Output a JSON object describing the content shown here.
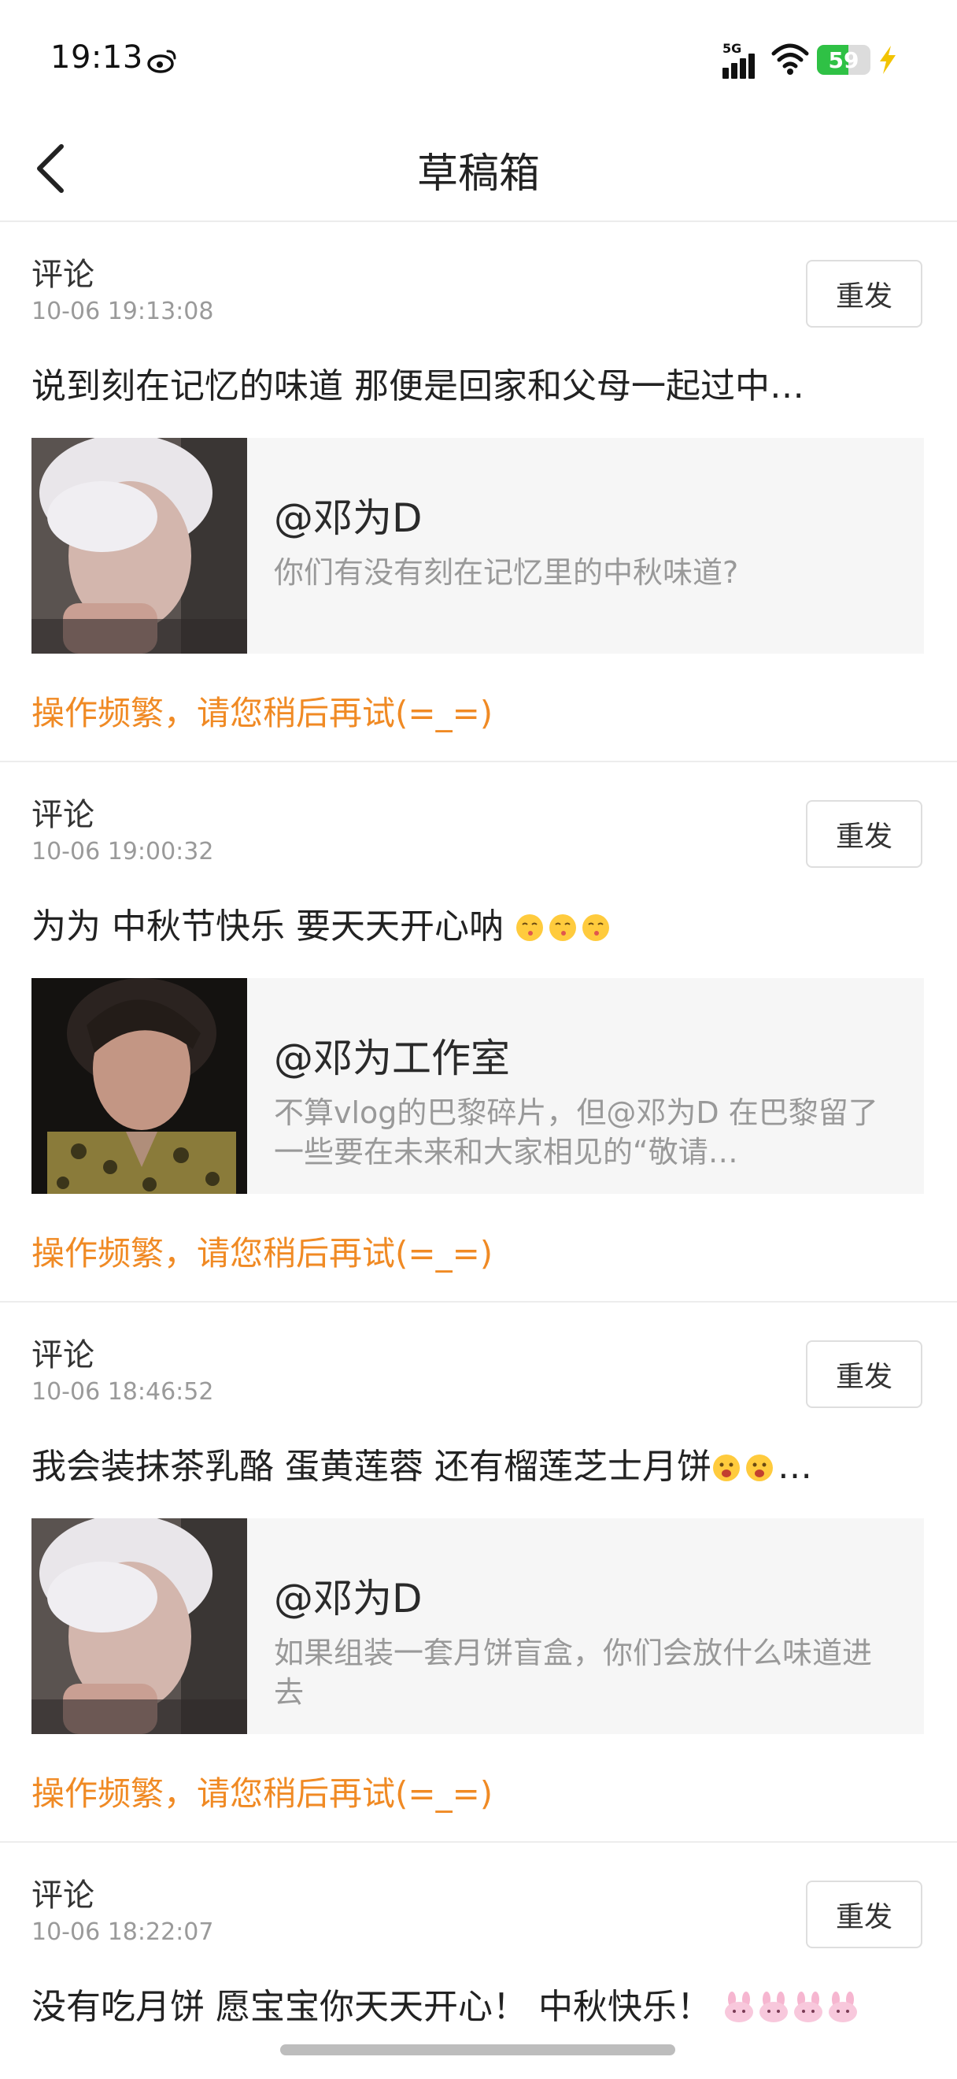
{
  "status_bar": {
    "time": "19:13",
    "network": "5G",
    "battery": "59",
    "battery_level": 0.59
  },
  "header": {
    "title": "草稿箱"
  },
  "drafts": [
    {
      "type": "评论",
      "time": "10-06 19:13:08",
      "resend": "重发",
      "text": "说到刻在记忆的味道 那便是回家和父母一起过中…",
      "quote_author": "@邓为D",
      "quote_text": "你们有没有刻在记忆里的中秋味道?",
      "error": "操作频繁，请您稍后再试(=_=)"
    },
    {
      "type": "评论",
      "time": "10-06 19:00:32",
      "resend": "重发",
      "text": "为为 中秋节快乐 要天天开心呐",
      "quote_author": "@邓为工作室",
      "quote_text": "不算vlog的巴黎碎片，但@邓为D 在巴黎留了一些要在未来和大家相见的“敬请…",
      "error": "操作频繁，请您稍后再试(=_=)"
    },
    {
      "type": "评论",
      "time": "10-06 18:46:52",
      "resend": "重发",
      "text": "我会装抹茶乳酪 蛋黄莲蓉 还有榴莲芝士月饼",
      "text_tail": "…",
      "quote_author": "@邓为D",
      "quote_text": "如果组装一套月饼盲盒，你们会放什么味道进去",
      "error": "操作频繁，请您稍后再试(=_=)"
    },
    {
      "type": "评论",
      "time": "10-06 18:22:07",
      "resend": "重发",
      "text": "没有吃月饼 愿宝宝你天天开心！ 中秋快乐！"
    }
  ]
}
